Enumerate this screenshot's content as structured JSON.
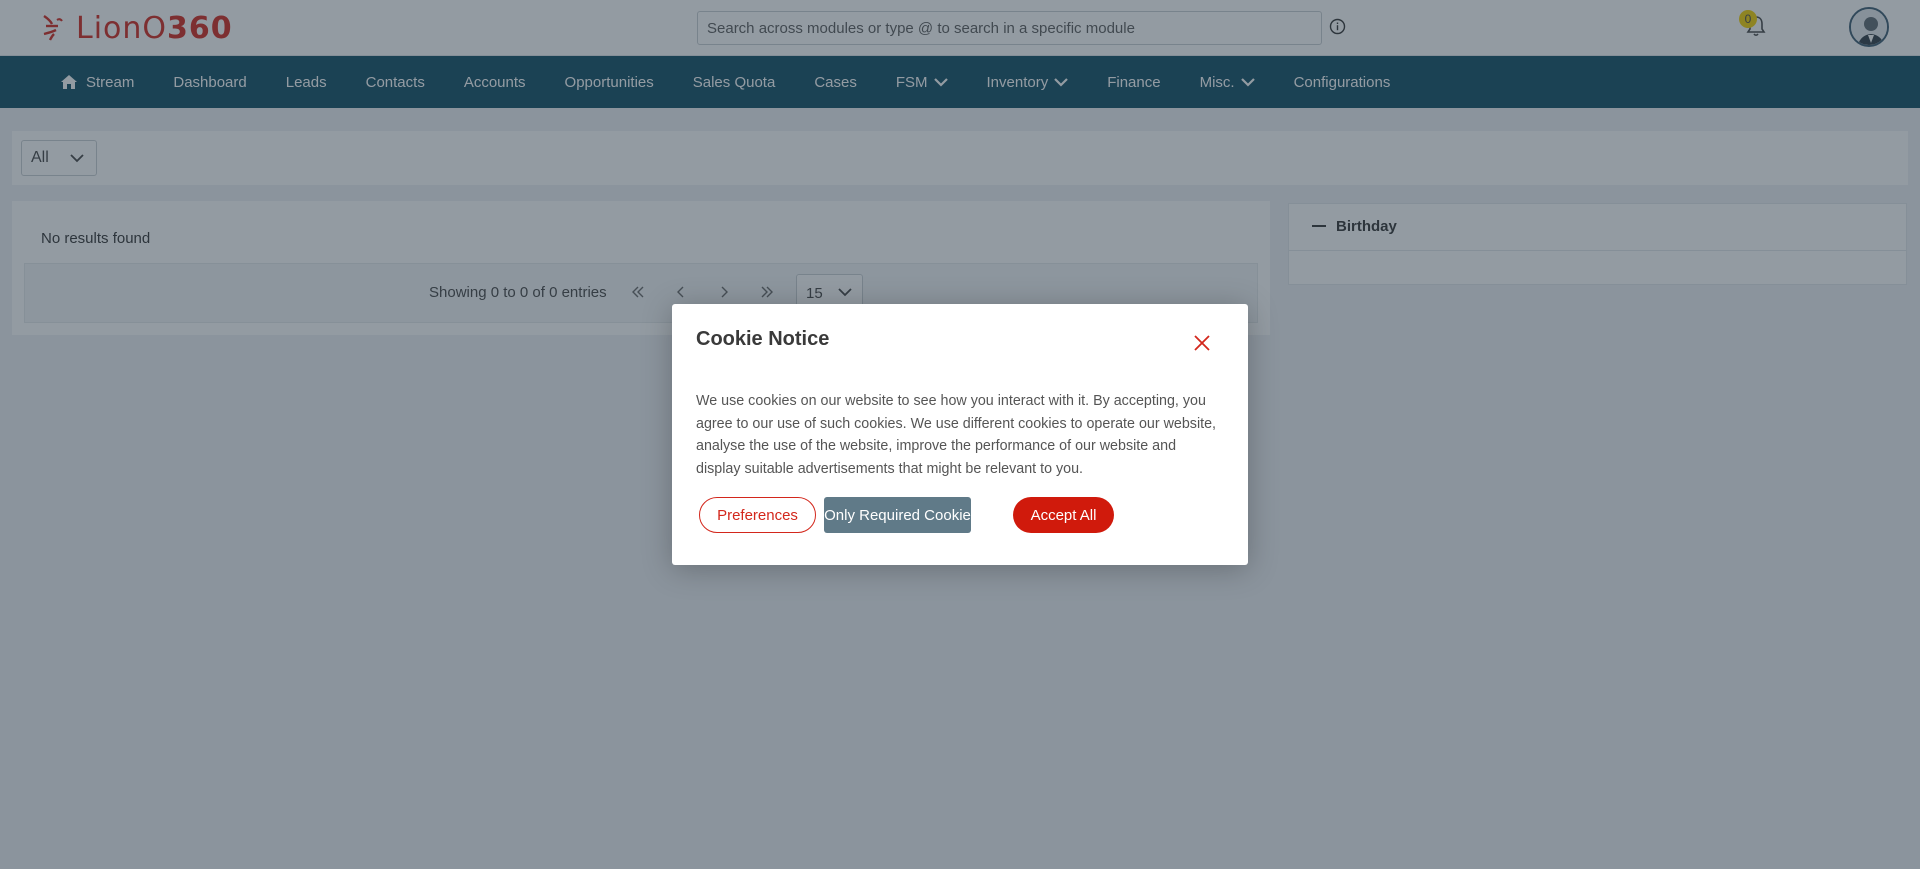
{
  "header": {
    "logo_text_prefix": "LionO",
    "logo_text_suffix": "360",
    "search_placeholder": "Search across modules or type @ to search in a specific module",
    "notification_count": "0"
  },
  "nav": {
    "items": [
      {
        "label": "Stream",
        "icon": "home-icon"
      },
      {
        "label": "Dashboard"
      },
      {
        "label": "Leads"
      },
      {
        "label": "Contacts"
      },
      {
        "label": "Accounts"
      },
      {
        "label": "Opportunities"
      },
      {
        "label": "Sales Quota"
      },
      {
        "label": "Cases"
      },
      {
        "label": "FSM",
        "dropdown": true
      },
      {
        "label": "Inventory",
        "dropdown": true
      },
      {
        "label": "Finance"
      },
      {
        "label": "Misc.",
        "dropdown": true
      },
      {
        "label": "Configurations"
      }
    ]
  },
  "filter": {
    "selected": "All"
  },
  "results": {
    "empty_text": "No results found",
    "showing_text": "Showing 0 to 0 of 0 entries",
    "page_size": "15"
  },
  "birthday": {
    "title": "Birthday"
  },
  "cookie_modal": {
    "title": "Cookie Notice",
    "body": "We use cookies on our website to see how you interact with it. By accepting, you agree to our use of such cookies. We use different cookies to operate our website, analyse the use of the website, improve the performance of our website and display suitable advertisements that might be relevant to you.",
    "preferences_label": "Preferences",
    "required_label": "Only Required Cookie",
    "accept_label": "Accept All"
  },
  "colors": {
    "brand_red": "#d3271c",
    "nav_bg": "#0f4c63",
    "required_btn": "#607a88"
  }
}
